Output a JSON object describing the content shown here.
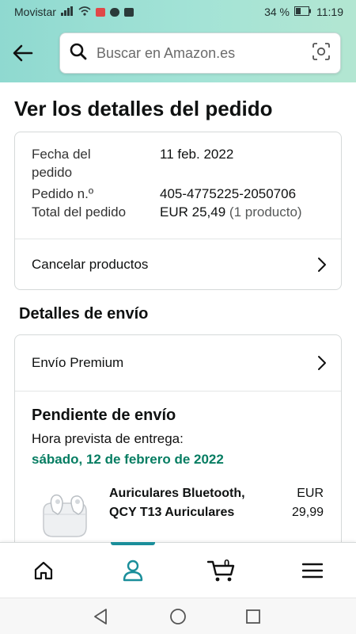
{
  "status_bar": {
    "carrier": "Movistar",
    "battery": "34 %",
    "time": "11:19"
  },
  "search": {
    "placeholder": "Buscar en Amazon.es",
    "value": ""
  },
  "page": {
    "title": "Ver los detalles del pedido"
  },
  "order": {
    "date_label": "Fecha del pedido",
    "date_value": "11 feb. 2022",
    "number_label": "Pedido n.º",
    "number_value": "405-4775225-2050706",
    "total_label": "Total del pedido",
    "total_value": "EUR 25,49",
    "total_note": "(1 producto)",
    "cancel_link": "Cancelar productos"
  },
  "shipping": {
    "section_title": "Detalles de envío",
    "method": "Envío Premium",
    "status_title": "Pendiente de envío",
    "eta_label": "Hora prevista de entrega:",
    "eta_date": "sábado, 12 de febrero de 2022"
  },
  "product": {
    "name": "Auriculares Bluetooth, QCY T13 Auriculares",
    "price_currency": "EUR",
    "price_amount": "29,99"
  },
  "bottom_nav": {
    "items": [
      "home-icon",
      "account-icon",
      "cart-icon",
      "menu-icon"
    ],
    "active": "account-icon",
    "cart_count": "0"
  },
  "colors": {
    "header": "#a3e3d6",
    "accent": "#1a8e9a",
    "delivery_green": "#067d62"
  }
}
